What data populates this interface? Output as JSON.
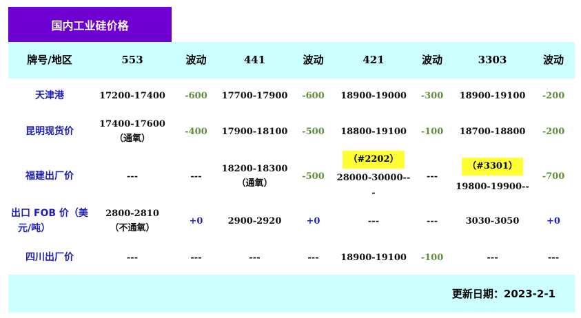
{
  "title": "国内工业硅价格",
  "headers": {
    "region": "牌号/地区",
    "g553": "553",
    "chg1": "波动",
    "g441": "441",
    "chg2": "波动",
    "g421": "421",
    "chg3": "波动",
    "g3303": "3303",
    "chg4": "波动"
  },
  "rows": [
    {
      "region": "天津港",
      "p553": "17200-17400",
      "c553": "-600",
      "p441": "17700-17900",
      "c441": "-600",
      "p421": "18900-19000",
      "c421": "-300",
      "p3303": "18900-19100",
      "c3303": "-200"
    },
    {
      "region": "昆明现货价",
      "p553": "17400-17600",
      "p553_note": "（通氧）",
      "c553": "-400",
      "p441": "17900-18100",
      "c441": "-500",
      "p421": "18800-19100",
      "c421": "-100",
      "p3303": "18700-18800",
      "c3303": "-200"
    },
    {
      "region": "福建出厂价",
      "p553": "---",
      "c553": "---",
      "p441": "18200-18300",
      "p441_note": "（通氧）",
      "c441": "-500",
      "p421_tag": "（#2202）",
      "p421": "28000-30000--",
      "p421_wrap": "-",
      "c421": "---",
      "p3303_tag": "（#3301）",
      "p3303": "19800-19900--",
      "c3303": "-700"
    },
    {
      "region_line1": "出口 FOB 价（美",
      "region_line2": "元/吨）",
      "p553": "2800-2810",
      "p553_note": "（不通氧）",
      "c553": "+0",
      "p441": "2900-2920",
      "c441": "+0",
      "p421": "---",
      "c421": "---",
      "p3303": "3030-3050",
      "c3303": "+0"
    },
    {
      "region": "四川出厂价",
      "p553": "---",
      "c553": "---",
      "p441": "---",
      "c441": "---",
      "p421": "18900-19100",
      "c421": "-100",
      "p3303": "---",
      "c3303": "---"
    }
  ],
  "footer": "更新日期：2023-2-1",
  "colors": {
    "title_bg": "#6f00d2",
    "band_bg": "#ccffff",
    "region_text": "#1f1fb5",
    "negative_change": "#5f8f3a",
    "positive_change": "#2020d0",
    "highlight": "#ffff33"
  }
}
